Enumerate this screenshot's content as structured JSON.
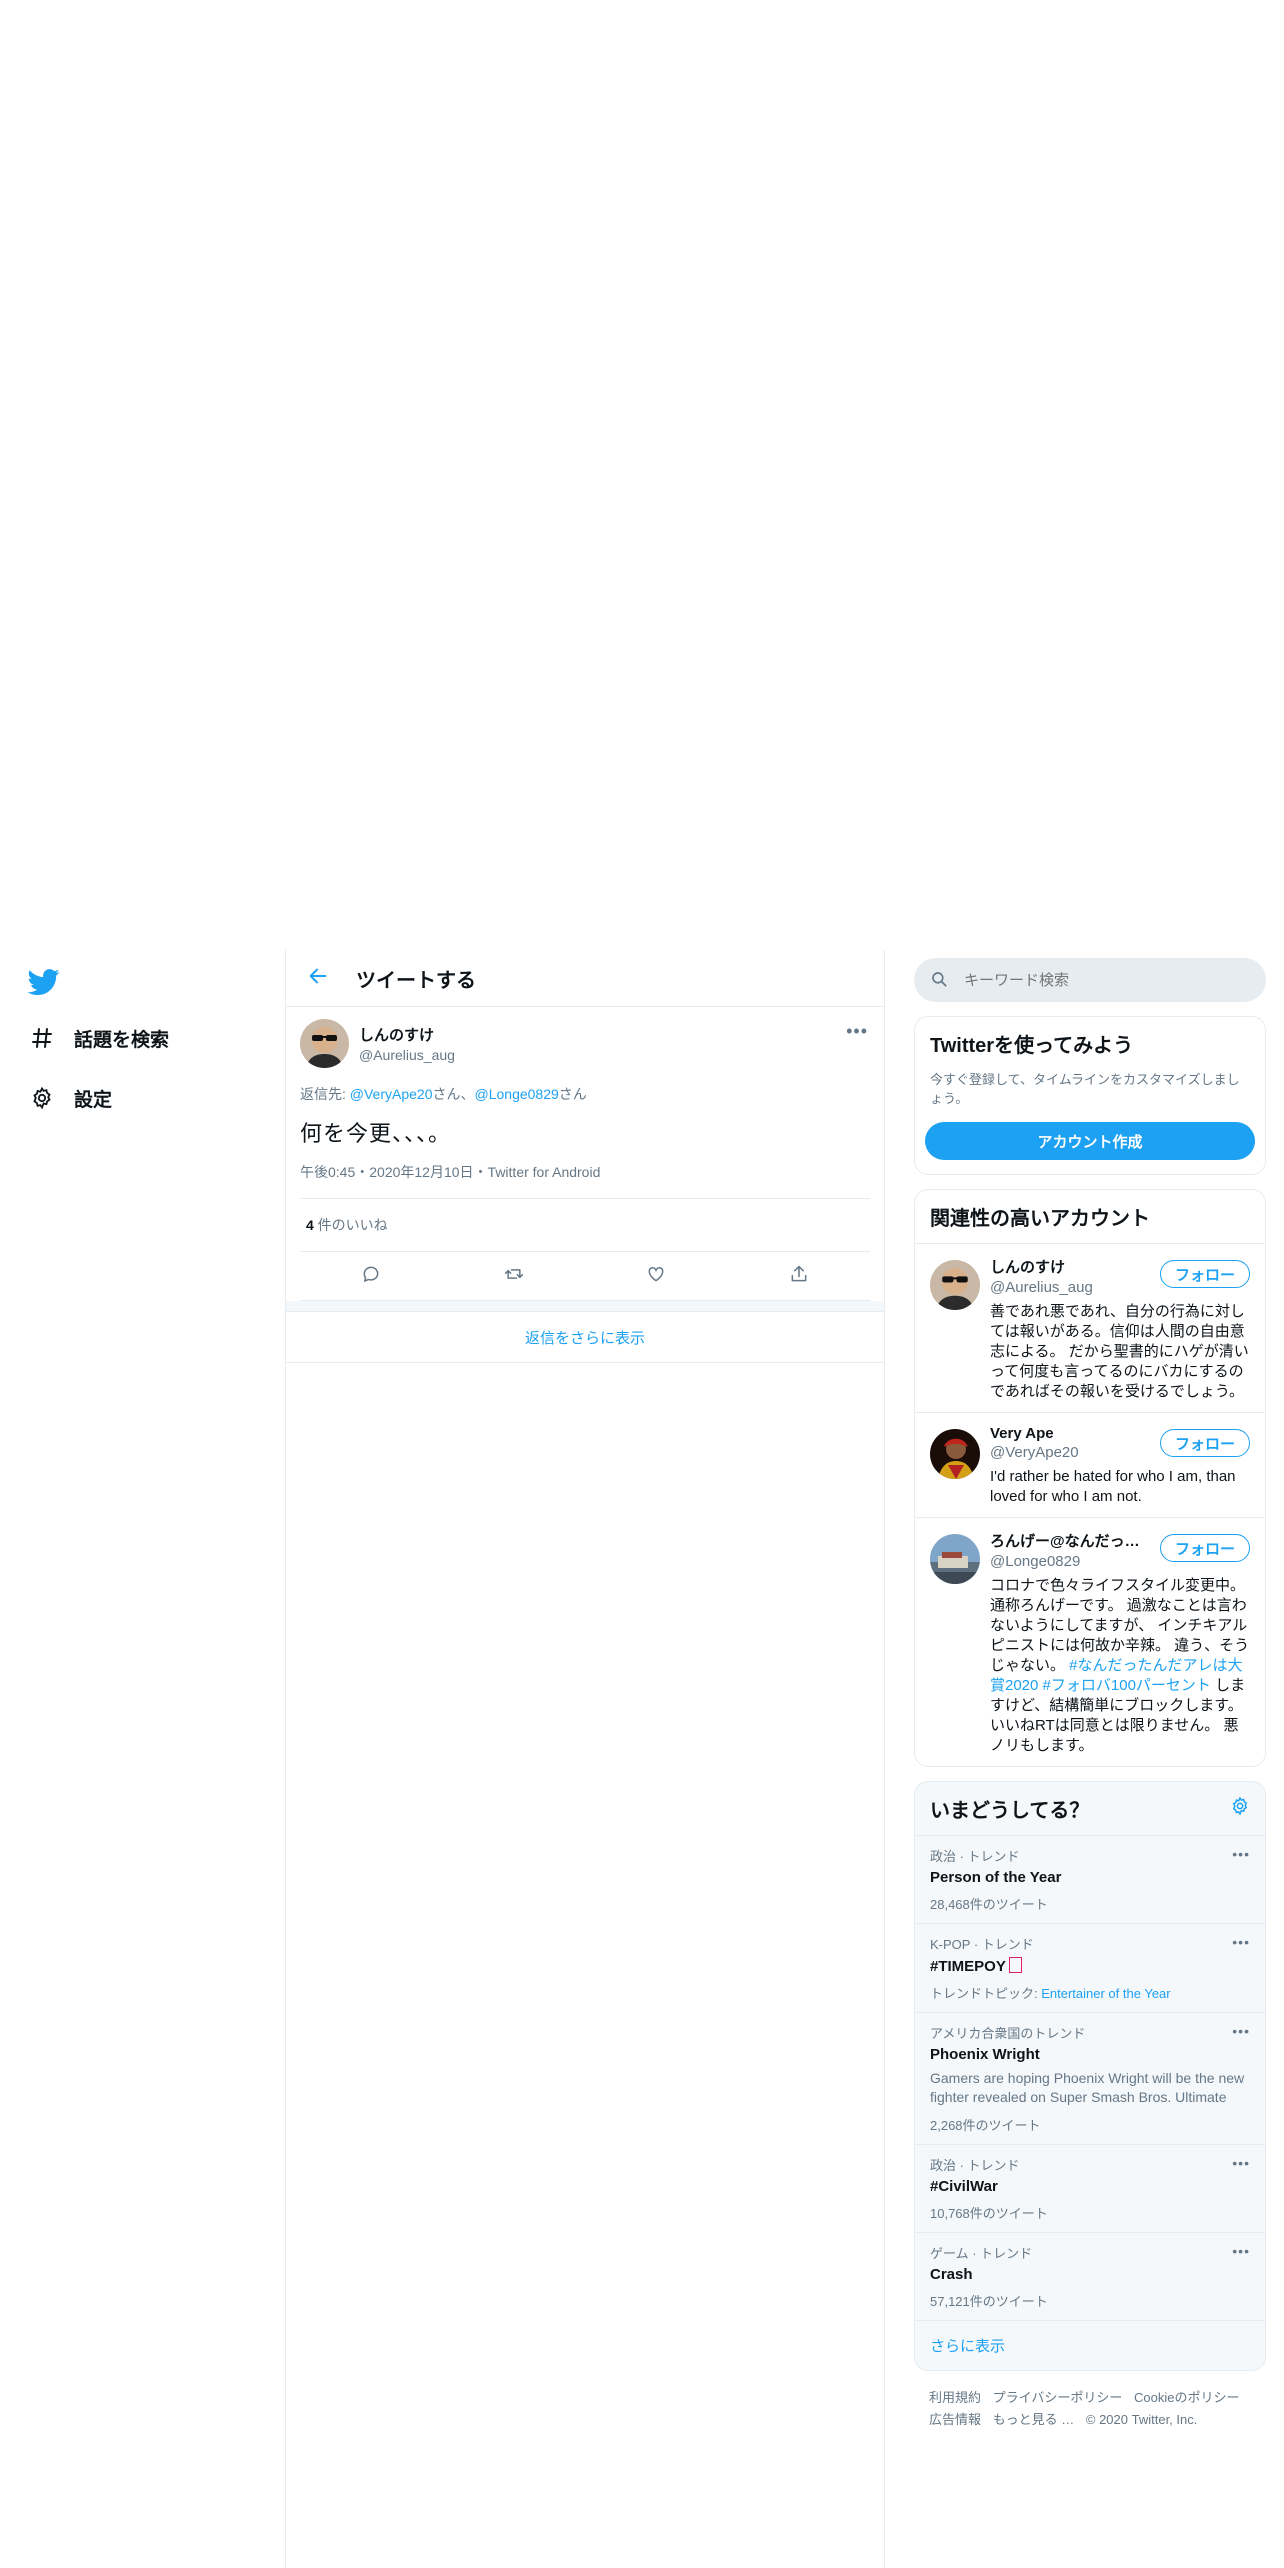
{
  "nav": {
    "items": [
      {
        "label": "話題を検索",
        "icon": "hashtag-icon"
      },
      {
        "label": "設定",
        "icon": "gear-icon"
      }
    ]
  },
  "main": {
    "header_title": "ツイートする",
    "tweet": {
      "display_name": "しんのすけ",
      "handle": "@Aurelius_aug",
      "reply_prefix": "返信先: ",
      "reply_user1": "@VeryApe20",
      "reply_sep": "さん、",
      "reply_user2": "@Longe0829",
      "reply_suffix": "さん",
      "text": "何を今更、、、。",
      "meta": "午後0:45・2020年12月10日・Twitter for Android",
      "likes_count": "4",
      "likes_label": " 件のいいね"
    },
    "show_more_replies": "返信をさらに表示"
  },
  "sidebar": {
    "search_placeholder": "キーワード検索",
    "try": {
      "title": "Twitterを使ってみよう",
      "desc": "今すぐ登録して、タイムラインをカスタマイズしましょう。",
      "button": "アカウント作成"
    },
    "related": {
      "title": "関連性の高いアカウント",
      "follow_label": "フォロー",
      "accounts": [
        {
          "name": "しんのすけ",
          "handle": "@Aurelius_aug",
          "bio": "善であれ悪であれ、自分の行為に対しては報いがある。信仰は人間の自由意志による。 だから聖書的にハゲが清いって何度も言ってるのにバカにするのであればその報いを受けるでしょう。"
        },
        {
          "name": "Very Ape",
          "handle": "@VeryApe20",
          "bio": "I'd rather be hated for who I am, than loved for who I am not."
        },
        {
          "name": "ろんげー@なんだった…",
          "handle": "@Longe0829",
          "bio_a": "コロナで色々ライフスタイル変更中。通称ろんげーです。 過激なことは言わないようにしてますが、 インチキアルピニストには何故か辛辣。 違う、そうじゃない。 ",
          "bio_tag": "#なんだったんだアレは大賞2020 #フォロバ100パーセント",
          "bio_b": " しますけど、結構簡単にブロックします。 いいねRTは同意とは限りません。 悪ノリもします。"
        }
      ]
    },
    "trends": {
      "title": "いまどうしてる？",
      "items": [
        {
          "context": "政治 · トレンド",
          "name": "Person of the Year",
          "count": "28,468件のツイート"
        },
        {
          "context": "K-POP · トレンド",
          "name": "#TIMEPOY",
          "topic_prefix": "トレンドトピック: ",
          "topic_link": "Entertainer of the Year"
        },
        {
          "context": "アメリカ合衆国のトレンド",
          "name": "Phoenix Wright",
          "desc": "Gamers are hoping Phoenix Wright will be the new fighter revealed on Super Smash Bros. Ultimate",
          "count": "2,268件のツイート"
        },
        {
          "context": "政治 · トレンド",
          "name": "#CivilWar",
          "count": "10,768件のツイート"
        },
        {
          "context": "ゲーム · トレンド",
          "name": "Crash",
          "count": "57,121件のツイート"
        }
      ],
      "show_more": "さらに表示"
    },
    "footer": {
      "links": [
        "利用規約",
        "プライバシーポリシー",
        "Cookieのポリシー",
        "広告情報",
        "もっと見る …"
      ],
      "copyright": "© 2020 Twitter, Inc."
    }
  },
  "colors": {
    "accent": "#1da1f2",
    "muted": "#657786",
    "border": "#e6ecf0",
    "card_gray": "#f5f8fa"
  }
}
